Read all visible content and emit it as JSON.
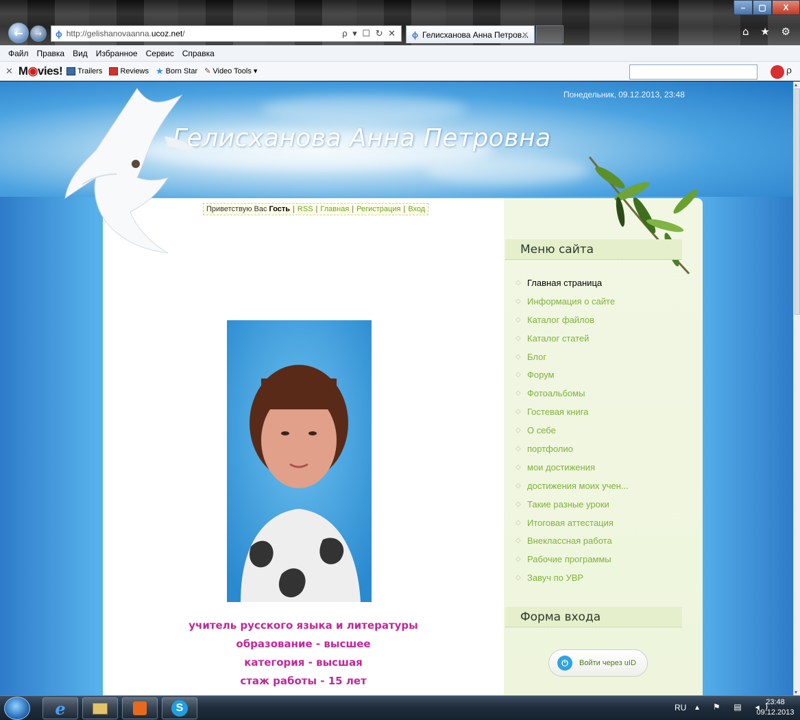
{
  "browser": {
    "address_prefix": "http://gelishanovaanna.",
    "address_domain": "ucoz.net",
    "address_suffix": "/",
    "address_actions": "ρ ▾ ☐ ↻ ✕",
    "tab_title": "Гелисханова Анна Петров...",
    "tab_close": "✕",
    "window_buttons": {
      "minimize": "–",
      "maximize": "▢",
      "close": "X"
    },
    "right_tools": "⌂ ★ ⚙",
    "menu": [
      "Файл",
      "Правка",
      "Вид",
      "Избранное",
      "Сервис",
      "Справка"
    ],
    "toolbar": {
      "close": "✕",
      "brand_prefix": "M",
      "brand_o": "◉",
      "brand_suffix": "vies!",
      "items": [
        "Trailers",
        "Reviews",
        "Born Star",
        "Video Tools ▾"
      ],
      "search_value": ""
    }
  },
  "site": {
    "date": "Понедельник, 09.12.2013, 23:48",
    "title": "Гелисханова Анна Петровна",
    "greeting": {
      "prefix": "Приветствую Вас",
      "guest": "Гость",
      "links": [
        "RSS",
        "Главная",
        "Регистрация",
        "Вход"
      ]
    },
    "profile_lines": [
      "учитель русского языка и литературы",
      "образование - высшее",
      "категория - высшая",
      "стаж работы - 15 лет"
    ],
    "menu_title": "Меню сайта",
    "menu_items": [
      "Главная страница",
      "Информация о сайте",
      "Каталог файлов",
      "Каталог статей",
      "Блог",
      "Форум",
      "Фотоальбомы",
      "Гостевая книга",
      "О себе",
      "портфолио",
      "мои достижения",
      "достижения моих учен...",
      "Такие разные уроки",
      "Итоговая аттестация",
      "Внеклассная работа",
      "Рабочие программы",
      "Завуч по УВР"
    ],
    "active_menu_index": 0,
    "login_title": "Форма входа",
    "uid_button": "Войти через uID"
  },
  "taskbar": {
    "lang": "RU",
    "tray": "▴ ⚑ ▤ ◂)",
    "time": "23:48",
    "date": "09.12.2013"
  },
  "colors": {
    "link_green": "#7eb23a",
    "profile_magenta": "#c0289a",
    "page_blue": "#5bbcf0"
  }
}
